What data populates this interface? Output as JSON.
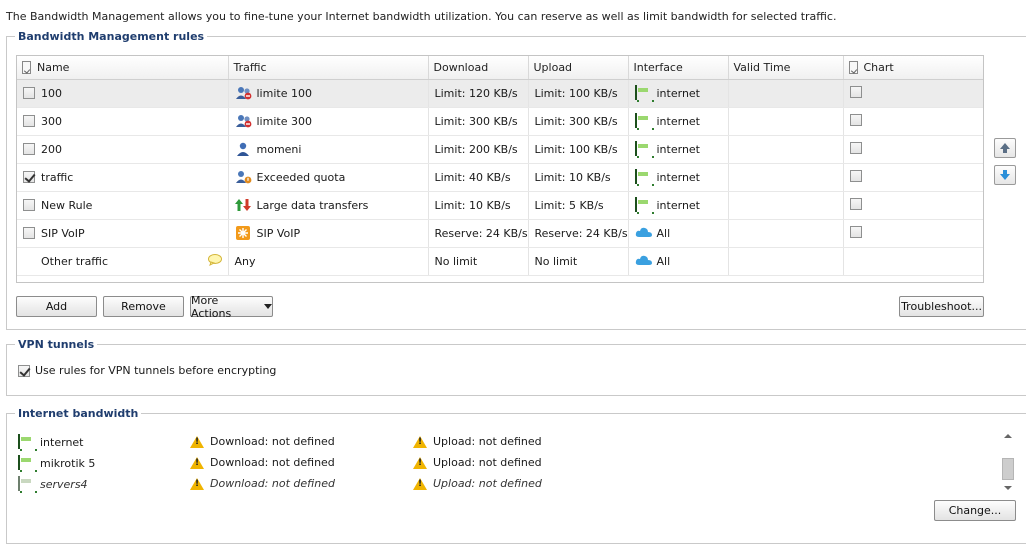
{
  "intro_text": "The Bandwidth Management allows you to fine-tune your Internet bandwidth utilization. You can reserve as well as limit bandwidth for selected traffic.",
  "rules_section": {
    "title": "Bandwidth Management rules",
    "columns": [
      "Name",
      "Traffic",
      "Download",
      "Upload",
      "Interface",
      "Valid Time",
      "Chart"
    ],
    "rows": [
      {
        "name": "100",
        "traffic": "limite 100",
        "traffic_icon": "users-limit-icon",
        "download": "Limit: 120 KB/s",
        "upload": "Limit: 100 KB/s",
        "interface": "internet",
        "interface_icon": "network-card-icon",
        "checked": false
      },
      {
        "name": "300",
        "traffic": "limite 300",
        "traffic_icon": "users-limit-icon",
        "download": "Limit: 300 KB/s",
        "upload": "Limit: 300 KB/s",
        "interface": "internet",
        "interface_icon": "network-card-icon",
        "checked": false
      },
      {
        "name": "200",
        "traffic": "momeni",
        "traffic_icon": "user-icon",
        "download": "Limit: 200 KB/s",
        "upload": "Limit: 100 KB/s",
        "interface": "internet",
        "interface_icon": "network-card-icon",
        "checked": false
      },
      {
        "name": "traffic",
        "traffic": "Exceeded quota",
        "traffic_icon": "user-quota-icon",
        "download": "Limit: 40 KB/s",
        "upload": "Limit: 10 KB/s",
        "interface": "internet",
        "interface_icon": "network-card-icon",
        "checked": true
      },
      {
        "name": "New Rule",
        "traffic": "Large data transfers",
        "traffic_icon": "transfer-arrows-icon",
        "download": "Limit: 10 KB/s",
        "upload": "Limit: 5 KB/s",
        "interface": "internet",
        "interface_icon": "network-card-icon",
        "checked": false
      },
      {
        "name": "SIP VoIP",
        "traffic": "SIP VoIP",
        "traffic_icon": "voip-icon",
        "download": "Reserve: 24 KB/s",
        "upload": "Reserve: 24 KB/s",
        "interface": "All",
        "interface_icon": "cloud-icon",
        "checked": false
      },
      {
        "name": "Other traffic",
        "traffic": "Any",
        "traffic_icon": "",
        "download": "No limit",
        "upload": "No limit",
        "interface": "All",
        "interface_icon": "cloud-icon",
        "checked": null
      }
    ],
    "buttons": {
      "add": "Add",
      "remove": "Remove",
      "more_actions": "More Actions",
      "troubleshoot": "Troubleshoot..."
    }
  },
  "vpn_section": {
    "title": "VPN tunnels",
    "checkbox_label": "Use rules for VPN tunnels before encrypting",
    "checked": true
  },
  "internet_bandwidth": {
    "title": "Internet bandwidth",
    "rows": [
      {
        "name": "internet",
        "download": "Download: not defined",
        "upload": "Upload: not defined",
        "italic": false
      },
      {
        "name": "mikrotik 5",
        "download": "Download: not defined",
        "upload": "Upload: not defined",
        "italic": false
      },
      {
        "name": "servers4",
        "download": "Download: not defined",
        "upload": "Upload: not defined",
        "italic": true
      }
    ],
    "change_button": "Change..."
  },
  "colors": {
    "accent": "#1f3d6e",
    "selected_row": "#ececec",
    "warning": "#f0b400",
    "interface_green": "#2f7d2f",
    "cloud_blue": "#3aa0e0"
  }
}
